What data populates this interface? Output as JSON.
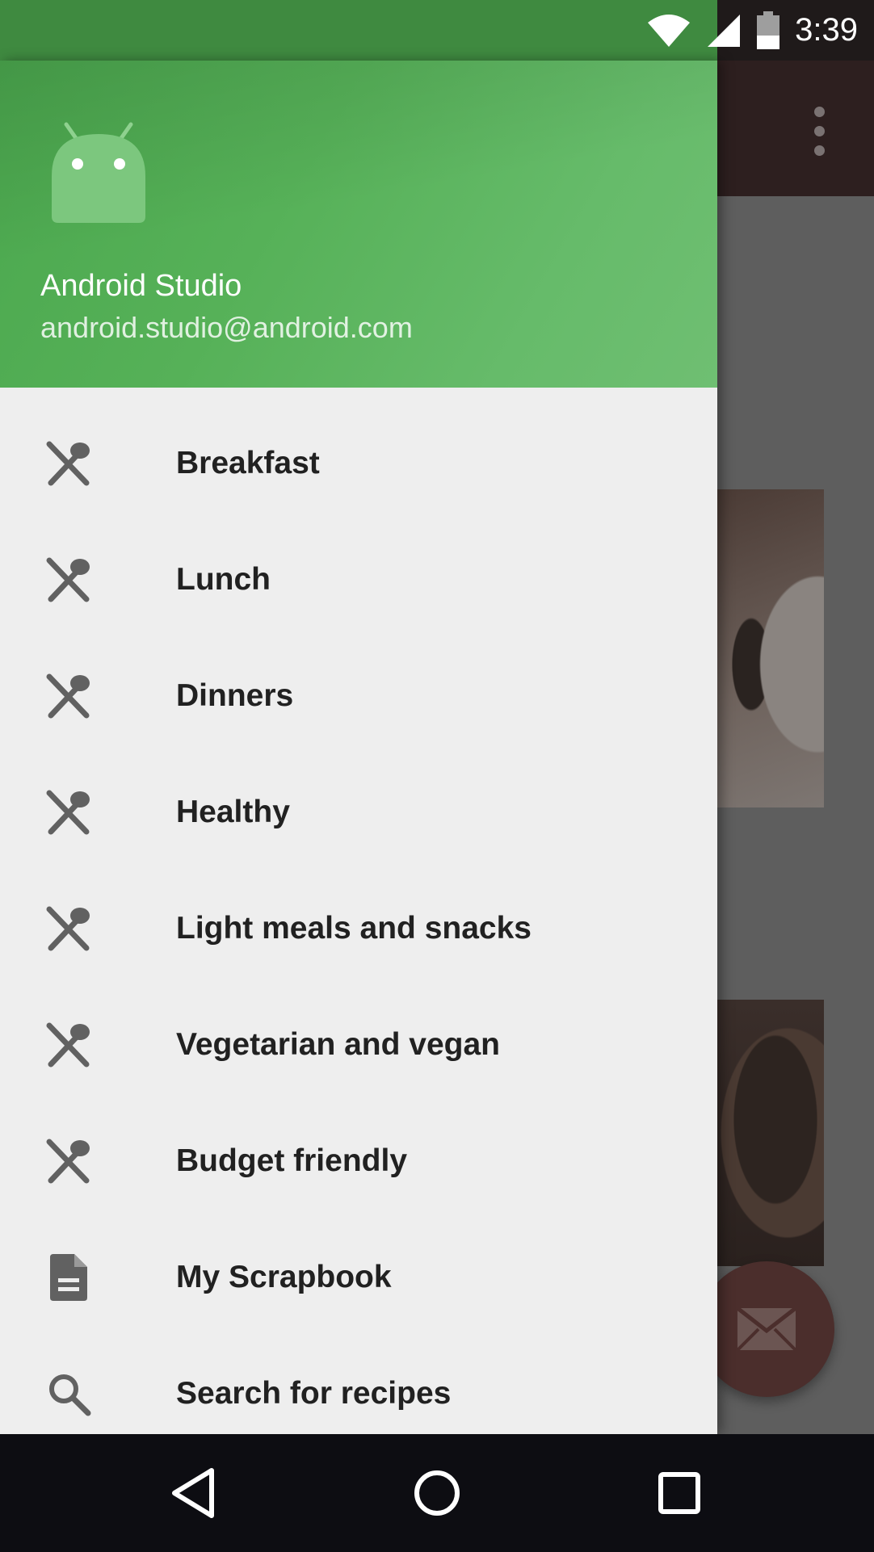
{
  "status_bar": {
    "time": "3:39",
    "icons": [
      "wifi-icon",
      "cell-signal-icon",
      "battery-icon"
    ]
  },
  "toolbar": {
    "overflow_icon": "more-vert-icon"
  },
  "fab": {
    "icon": "email-icon"
  },
  "drawer": {
    "header": {
      "avatar_icon": "android-robot-icon",
      "name": "Android Studio",
      "email": "android.studio@android.com",
      "accent_color": "#66bb6a"
    },
    "items": [
      {
        "label": "Breakfast",
        "icon": "fork-spoon-icon"
      },
      {
        "label": "Lunch",
        "icon": "fork-spoon-icon"
      },
      {
        "label": "Dinners",
        "icon": "fork-spoon-icon"
      },
      {
        "label": "Healthy",
        "icon": "fork-spoon-icon"
      },
      {
        "label": "Light meals and snacks",
        "icon": "fork-spoon-icon"
      },
      {
        "label": "Vegetarian and vegan",
        "icon": "fork-spoon-icon"
      },
      {
        "label": "Budget friendly",
        "icon": "fork-spoon-icon"
      },
      {
        "label": "My Scrapbook",
        "icon": "document-icon"
      },
      {
        "label": "Search for recipes",
        "icon": "search-icon"
      }
    ]
  },
  "nav_bar": {
    "buttons": [
      "back-icon",
      "home-icon",
      "recents-icon"
    ]
  }
}
